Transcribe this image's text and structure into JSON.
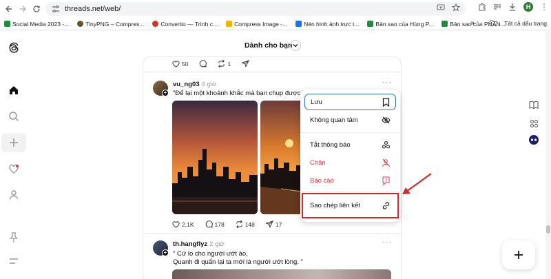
{
  "browser": {
    "url": "threads.net/web/",
    "profile_initial": "H",
    "bookmarks": [
      {
        "label": "Social Media 2023 -...",
        "color": "#1e8e3e"
      },
      {
        "label": "TinyPNG – Compres...",
        "color": "#6b4f2a"
      },
      {
        "label": "Convertio — Trình c...",
        "color": "#d93025"
      },
      {
        "label": "Compress Image -...",
        "color": "#f4b400"
      },
      {
        "label": "Nén hình ảnh trực t...",
        "color": "#1a73e8"
      },
      {
        "label": "Bản sao của Hùng P...",
        "color": "#1e8e3e"
      },
      {
        "label": "Bản sao của PHẦN...",
        "color": "#1e8e3e"
      }
    ],
    "bookmarks_overflow": "»",
    "all_bookmarks": "Tất cả dấu trang"
  },
  "feed": {
    "title": "Dành cho bạn"
  },
  "top_post_actions": {
    "likes": "50",
    "reposts": "1"
  },
  "post1": {
    "username": "vu_ng03",
    "time": "4 giờ",
    "text": "\"Để lại một khoảnh khắc mà bạn chụp được.\"",
    "likes": "2,1K",
    "comments": "178",
    "reposts": "148",
    "shares": "17"
  },
  "post2": {
    "username": "th.hangflyz",
    "time": "2 giờ",
    "line1": "\" Cứ lo cho người ướt áo,",
    "line2": "Quanh đi quẩn lại ta mới là người ướt lòng. \""
  },
  "menu": {
    "save": "Lưu",
    "not_interested": "Không quan tâm",
    "mute": "Tắt thông báo",
    "block": "Chặn",
    "report": "Báo cáo",
    "copy_link": "Sao chép liên kết"
  },
  "colors": {
    "danger": "#e0374f",
    "highlight": "#d12a2a",
    "accent": "#2d6ea8"
  }
}
